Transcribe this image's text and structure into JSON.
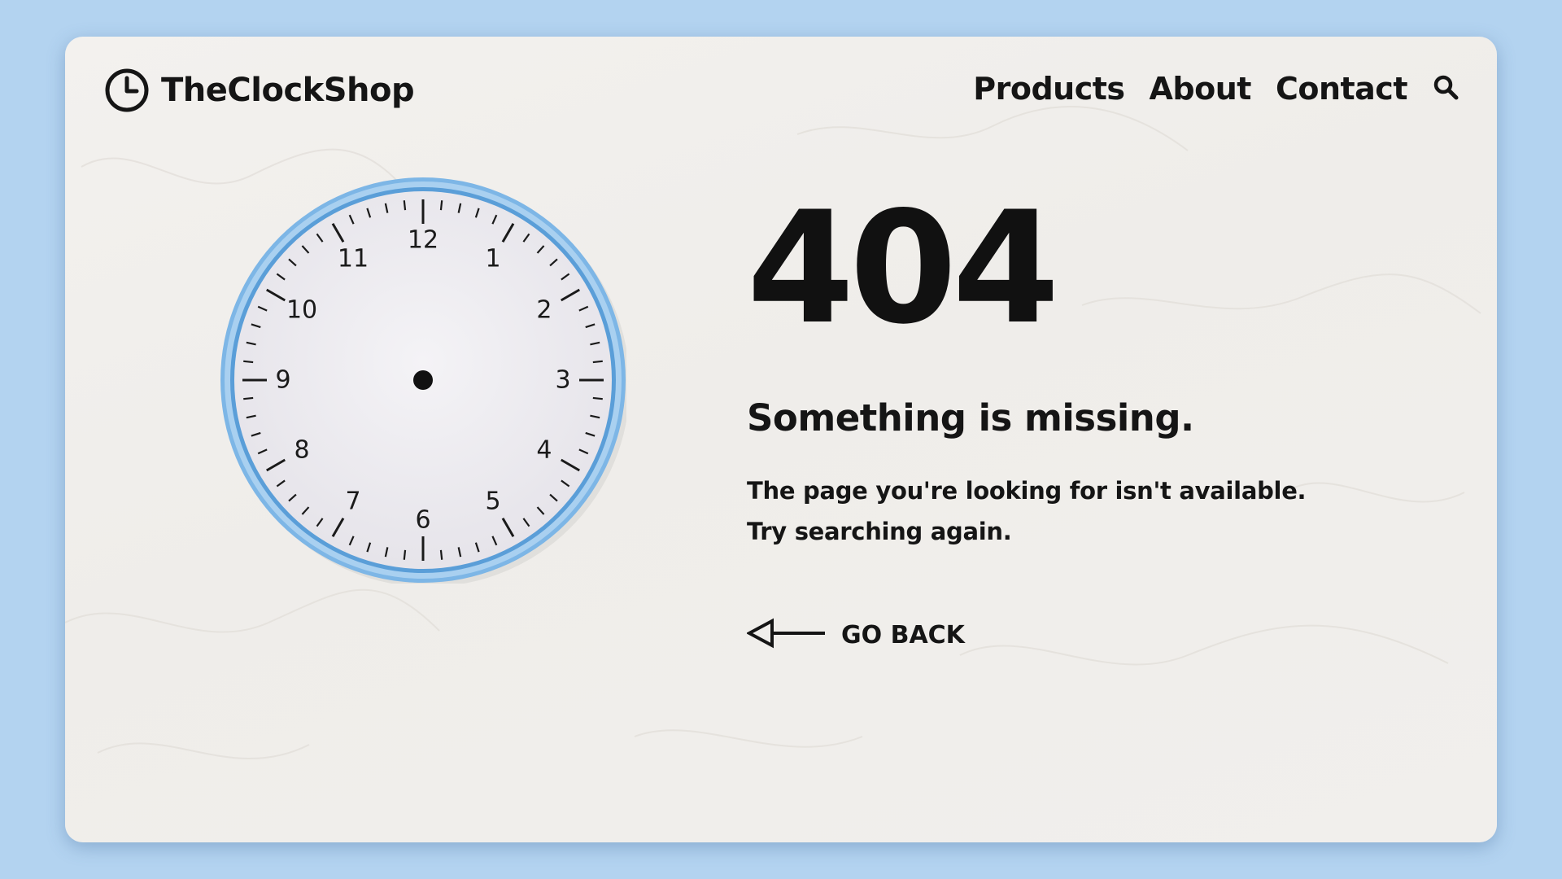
{
  "header": {
    "brand": "TheClockShop",
    "logo_icon": "clock-icon",
    "nav": [
      {
        "label": "Products"
      },
      {
        "label": "About"
      },
      {
        "label": "Contact"
      }
    ],
    "search_icon": "search-icon"
  },
  "clock": {
    "numerals": [
      "12",
      "1",
      "2",
      "3",
      "4",
      "5",
      "6",
      "7",
      "8",
      "9",
      "10",
      "11"
    ]
  },
  "main": {
    "error_code": "404",
    "headline": "Something is missing.",
    "description_line1": "The page you're looking for isn't available.",
    "description_line2": "Try searching again."
  },
  "actions": {
    "go_back_label": "GO BACK",
    "go_back_icon": "arrow-left-icon"
  },
  "colors": {
    "background": "#b3d3f0",
    "card": "#f1efec",
    "text": "#151515",
    "clock_rim": "#6aa8de"
  }
}
